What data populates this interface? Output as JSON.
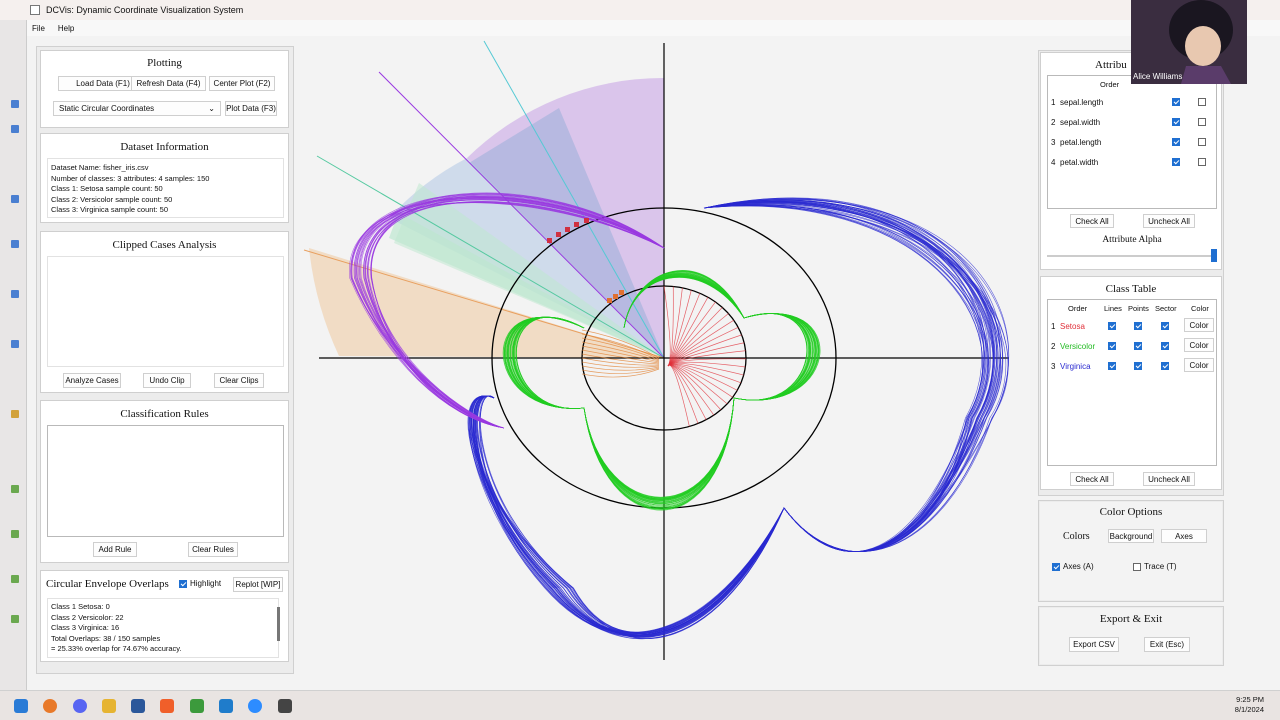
{
  "window": {
    "title": "DCVis: Dynamic Coordinate Visualization System"
  },
  "menu": [
    "File",
    "Help"
  ],
  "plotting": {
    "title": "Plotting",
    "load": "Load Data (F1)",
    "refresh": "Refresh Data (F4)",
    "center": "Center Plot (F2)",
    "mode": "Static Circular Coordinates",
    "plot": "Plot Data (F3)"
  },
  "dataset": {
    "title": "Dataset Information",
    "lines": [
      "Dataset Name: fisher_iris.csv",
      "Number of classes: 3 attributes: 4 samples: 150",
      "Class 1: Setosa sample count: 50",
      "Class 2: Versicolor sample count: 50",
      "Class 3: Virginica sample count: 50"
    ]
  },
  "clipped": {
    "title": "Clipped Cases Analysis",
    "analyze": "Analyze Cases",
    "undo": "Undo Clip",
    "clear": "Clear Clips"
  },
  "rules": {
    "title": "Classification Rules",
    "add": "Add Rule",
    "clear": "Clear Rules"
  },
  "overlaps": {
    "title": "Circular Envelope Overlaps",
    "highlight": "Highlight",
    "replot": "Replot [WIP]",
    "lines": [
      "Class 1 Setosa: 0",
      "Class 2 Versicolor: 22",
      "Class 3 Virginica: 16",
      "Total Overlaps: 38 / 150 samples",
      "= 25.33% overlap for 74.67% accuracy."
    ]
  },
  "attributes": {
    "title": "Attribu",
    "order_header": "Order",
    "rows": [
      {
        "num": "1",
        "name": "sepal.length"
      },
      {
        "num": "2",
        "name": "sepal.width"
      },
      {
        "num": "3",
        "name": "petal.length"
      },
      {
        "num": "4",
        "name": "petal.width"
      }
    ],
    "check_all": "Check All",
    "uncheck_all": "Uncheck All",
    "alpha_label": "Attribute Alpha"
  },
  "class_table": {
    "title": "Class Table",
    "headers": [
      "Order",
      "Lines",
      "Points",
      "Sector",
      "Color"
    ],
    "rows": [
      {
        "num": "1",
        "name": "Setosa",
        "color": "#e0303a",
        "btn": "Color"
      },
      {
        "num": "2",
        "name": "Versicolor",
        "color": "#22bb22",
        "btn": "Color"
      },
      {
        "num": "3",
        "name": "Virginica",
        "color": "#2a2ad0",
        "btn": "Color"
      }
    ],
    "check_all": "Check All",
    "uncheck_all": "Uncheck All"
  },
  "color_options": {
    "title": "Color Options",
    "colors_label": "Colors",
    "background": "Background",
    "axes": "Axes",
    "axes_cb": "Axes (A)",
    "trace_cb": "Trace (T)"
  },
  "export": {
    "title": "Export & Exit",
    "csv": "Export CSV",
    "exit": "Exit (Esc)"
  },
  "webcam": {
    "name": "Alice Williams"
  },
  "clock": {
    "time": "9:25 PM",
    "date": "8/1/2024"
  },
  "colors": {
    "setosa": "#e0303a",
    "versicolor": "#22cc22",
    "virginica": "#2a2ad0",
    "purple": "#9a3ae0",
    "accent": "#1f6fd1"
  }
}
